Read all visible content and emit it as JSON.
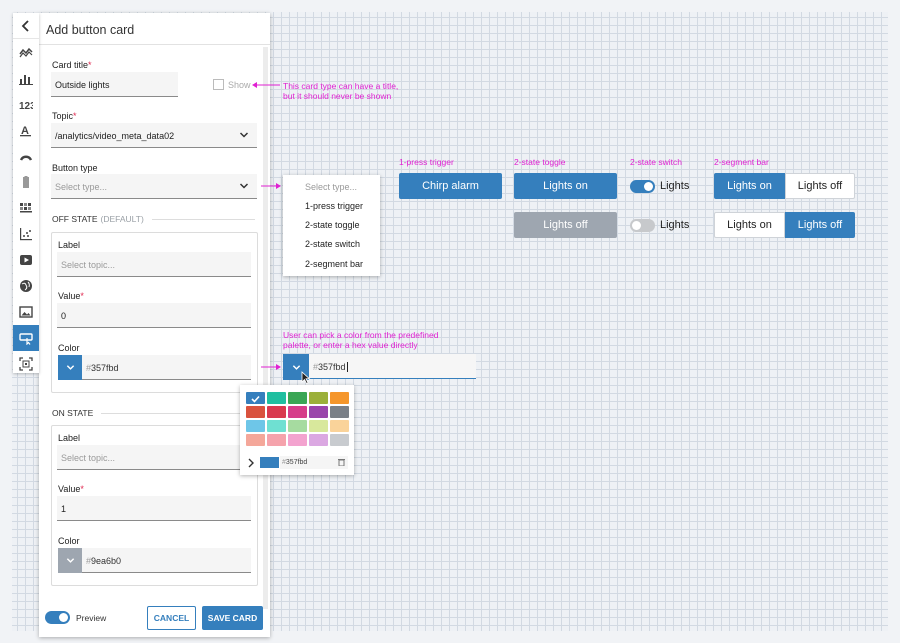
{
  "panel": {
    "title": "Add button card",
    "card_title": {
      "label": "Card title",
      "value": "Outside lights",
      "show_label": "Show"
    },
    "topic": {
      "label": "Topic",
      "value": "/analytics/video_meta_data02"
    },
    "button_type": {
      "label": "Button type",
      "placeholder": "Select type..."
    },
    "off_state": {
      "heading": "OFF STATE",
      "heading_muted": "(DEFAULT)",
      "label": {
        "label": "Label",
        "placeholder": "Select topic..."
      },
      "value": {
        "label": "Value",
        "value": "0"
      },
      "color": {
        "label": "Color",
        "hash": "#",
        "hex": "357fbd",
        "swatch": "#357fbd"
      }
    },
    "on_state": {
      "heading": "ON STATE",
      "label": {
        "label": "Label",
        "placeholder": "Select topic..."
      },
      "value": {
        "label": "Value",
        "value": "1"
      },
      "color": {
        "label": "Color",
        "hash": "#",
        "hex": "9ea6b0",
        "swatch": "#9ea6b0"
      }
    },
    "footer": {
      "preview_label": "Preview",
      "cancel": "CANCEL",
      "save": "SAVE CARD"
    }
  },
  "rail_icons": [
    "back-icon",
    "line-chart-icon",
    "bar-chart-icon",
    "number-icon",
    "text-icon",
    "gauge-icon",
    "battery-icon",
    "heatmap-icon",
    "scatter-icon",
    "video-icon",
    "globe-icon",
    "image-icon",
    "button-icon",
    "qr-icon"
  ],
  "notes": {
    "title_note": [
      "This card type can have a title,",
      "but it should never be shown"
    ],
    "color_note": [
      "User can pick a color from the predefined",
      "palette, or enter a hex value directly"
    ]
  },
  "dropdown": {
    "placeholder": "Select type...",
    "options": [
      "1-press trigger",
      "2-state toggle",
      "2-state switch",
      "2-segment bar"
    ]
  },
  "color_picker": {
    "hash": "#",
    "hex": "357fbd",
    "palette_hash": "#",
    "palette_hex": "357fbd",
    "selected": "#357fbd",
    "palette": [
      [
        "#357fbd",
        "#1fbfa0",
        "#3aa655",
        "#9bb03a",
        "#f5962b"
      ],
      [
        "#d9523e",
        "#d9394f",
        "#d63d8a",
        "#9a45ab",
        "#7a8088"
      ],
      [
        "#6ec6e8",
        "#6fe0d2",
        "#a6dba0",
        "#d8e89c",
        "#fad39a"
      ],
      [
        "#f4a79a",
        "#f5a3ac",
        "#f3a3cf",
        "#dba8e2",
        "#c8cbcf"
      ]
    ]
  },
  "previews": {
    "trigger": {
      "caption": "1-press trigger",
      "label": "Chirp alarm"
    },
    "toggle": {
      "caption": "2-state toggle",
      "on": "Lights on",
      "off": "Lights off"
    },
    "switch": {
      "caption": "2-state switch",
      "on_label": "Lights",
      "off_label": "Lights"
    },
    "bar": {
      "caption": "2-segment bar",
      "on": "Lights on",
      "off": "Lights off"
    }
  }
}
